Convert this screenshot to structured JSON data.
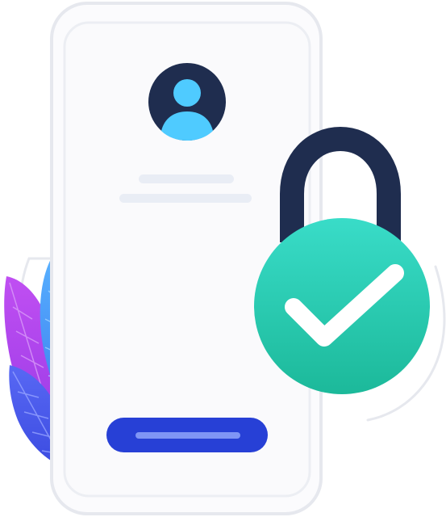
{
  "colors": {
    "background": "#ffffff",
    "phone_fill": "#fbfbfd",
    "phone_border": "#e6e8ee",
    "avatar_bg": "#1f2d4f",
    "avatar_person": "#4fcbff",
    "placeholder_line": "#e9edf5",
    "button_fill": "#2740d6",
    "button_line": "#7f95f5",
    "shackle": "#1f2d4f",
    "lock_body_top": "#39dcc8",
    "lock_body_bottom": "#1cb99a",
    "checkmark": "#ffffff",
    "leaf_purple": "#b349f0",
    "leaf_blue": "#48a2f7",
    "leaf_indigo": "#4a5cf0"
  },
  "icons": {
    "avatar": "user-avatar-icon",
    "lock": "padlock-icon",
    "check": "checkmark-icon",
    "plant": "leaves-decoration-icon"
  }
}
